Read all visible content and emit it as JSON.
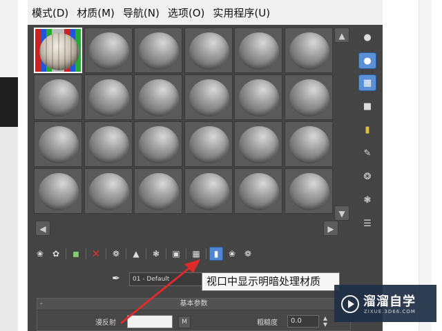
{
  "menu": {
    "items": [
      {
        "label": "模式(D)"
      },
      {
        "label": "材质(M)"
      },
      {
        "label": "导航(N)"
      },
      {
        "label": "选项(O)"
      },
      {
        "label": "实用程序(U)"
      }
    ]
  },
  "sample_slots": {
    "rows": 4,
    "columns": 6,
    "active_slot": 1
  },
  "slot_name": "01 - Default",
  "tooltip": "视口中显示明暗处理材质",
  "rollout": {
    "toggle": "-",
    "title": "基本参数",
    "diffuse_label": "漫反射",
    "map_button": "M",
    "roughness_label": "粗糙度",
    "roughness_value": "0.0"
  },
  "watermark": {
    "title": "溜溜自学",
    "subtitle": "ZIXUE.3D66.COM"
  },
  "colors": {
    "accent_blue": "#5b8fd6",
    "panel_bg": "#444444",
    "arrow_red": "#e02a2a"
  }
}
